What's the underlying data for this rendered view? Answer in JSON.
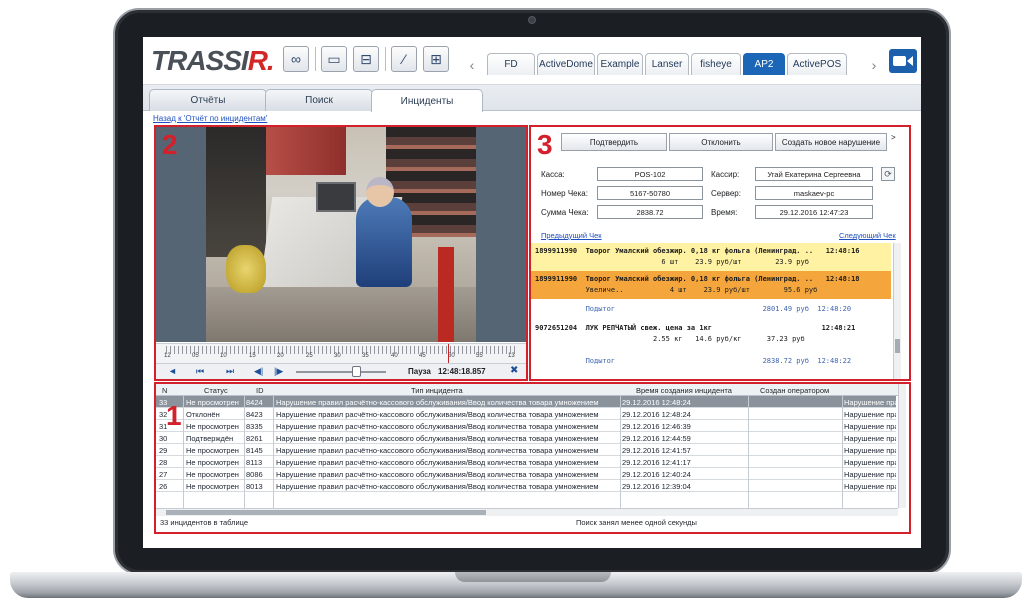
{
  "logo": {
    "text_main": "TRASSI",
    "text_accent": "R",
    "trail": "."
  },
  "toolbar": {
    "icons": [
      "pair-view-icon",
      "monitor-icon",
      "tree-icon",
      "magic-wand-icon",
      "layout-edit-icon"
    ]
  },
  "camera_tabs": {
    "prev": "‹",
    "next": "›",
    "items": [
      {
        "label": "FD"
      },
      {
        "label": "ActiveDome"
      },
      {
        "label": "Example"
      },
      {
        "label": "Lanser"
      },
      {
        "label": "fisheye"
      },
      {
        "label": "AP2",
        "active": true
      },
      {
        "label": "ActivePOS"
      }
    ]
  },
  "main_tabs": [
    {
      "label": "Отчёты"
    },
    {
      "label": "Поиск"
    },
    {
      "label": "Инциденты",
      "active": true
    }
  ],
  "back_link": "Назад к 'Отчёт по инцидентам'",
  "panel_labels": {
    "video": "2",
    "receipt": "3",
    "table": "1"
  },
  "video": {
    "tick_labels": [
      "12",
      "05",
      "10",
      "15",
      "20",
      "25",
      "30",
      "35",
      "40",
      "45",
      "50",
      "55",
      "13"
    ],
    "controls": {
      "prev_frame": "◄",
      "skip_back": "⏮",
      "skip_fwd": "⏭",
      "step_back": "◀|",
      "step_fwd": "|▶"
    },
    "state_label": "Пауза",
    "time": "12:48:18.857",
    "close": "✖"
  },
  "receipt_panel": {
    "buttons": {
      "confirm": "Подтвердить",
      "reject": "Отклонить",
      "new_violation": "Создать новое нарушение",
      "more": ">"
    },
    "fields": {
      "kassa_label": "Касса:",
      "kassa_value": "POS-102",
      "cashier_label": "Кассир:",
      "cashier_value": "Угай Екатерина Сергеевна",
      "check_num_label": "Номер Чека:",
      "check_num_value": "5167-50780",
      "server_label": "Сервер:",
      "server_value": "maskaev-pc",
      "sum_label": "Сумма Чека:",
      "sum_value": "2838.72",
      "time_label": "Время:",
      "time_value": "29.12.2016 12:47:23"
    },
    "prev_check": "Предыдущий Чек",
    "next_check": "Следующий Чек",
    "lines": [
      {
        "l1": "1899911990  Творог Умалский обезжир. 0,18 кг фольга (Ленинград. ..   12:48:16",
        "l2": "                              6 шт    23.9 руб/шт        23.9 руб",
        "style": "yellow"
      },
      {
        "l1": "1899911990  Творог Умалский обезжир. 0,18 кг фольга (Ленинград. ..   12:48:18",
        "l2": "            Увеличе..           4 шт    23.9 руб/шт        95.6 руб",
        "style": "orange"
      },
      {
        "l1": "            Подытог                                   2801.49 руб  12:48:20",
        "l2": "",
        "style": "sub"
      },
      {
        "l1": "9072651204  ЛУК РЕПЧАТЫЙ свеж. цена за 1кг                          12:48:21",
        "l2": "                            2.55 кг   14.6 руб/кг      37.23 руб",
        "style": "plain"
      },
      {
        "l1": "            Подытог                                   2838.72 руб  12:48:22",
        "l2": "",
        "style": "sub"
      }
    ]
  },
  "table": {
    "headers": [
      "N",
      "Статус",
      "ID",
      "Тип инцидента",
      "Время создания инцидента",
      "Создан оператором",
      ""
    ],
    "rows": [
      {
        "n": "33",
        "status": "Не просмотрен",
        "id": "8424",
        "type": "Нарушение правил расчётно-кассового обслуживания/Ввод количества товара умножением",
        "time": "29.12.2016 12:48:24",
        "op": "",
        "extra": "Нарушение пра"
      },
      {
        "n": "32",
        "status": "Отклонён",
        "id": "8423",
        "type": "Нарушение правил расчётно-кассового обслуживания/Ввод количества товара умножением",
        "time": "29.12.2016 12:48:24",
        "op": "",
        "extra": "Нарушение пра"
      },
      {
        "n": "31",
        "status": "Не просмотрен",
        "id": "8335",
        "type": "Нарушение правил расчётно-кассового обслуживания/Ввод количества товара умножением",
        "time": "29.12.2016 12:46:39",
        "op": "",
        "extra": "Нарушение пра"
      },
      {
        "n": "30",
        "status": "Подтверждён",
        "id": "8261",
        "type": "Нарушение правил расчётно-кассового обслуживания/Ввод количества товара умножением",
        "time": "29.12.2016 12:44:59",
        "op": "",
        "extra": "Нарушение пра"
      },
      {
        "n": "29",
        "status": "Не просмотрен",
        "id": "8145",
        "type": "Нарушение правил расчётно-кассового обслуживания/Ввод количества товара умножением",
        "time": "29.12.2016 12:41:57",
        "op": "",
        "extra": "Нарушение пра"
      },
      {
        "n": "28",
        "status": "Не просмотрен",
        "id": "8113",
        "type": "Нарушение правил расчётно-кассового обслуживания/Ввод количества товара умножением",
        "time": "29.12.2016 12:41:17",
        "op": "",
        "extra": "Нарушение пра"
      },
      {
        "n": "27",
        "status": "Не просмотрен",
        "id": "8086",
        "type": "Нарушение правил расчётно-кассового обслуживания/Ввод количества товара умножением",
        "time": "29.12.2016 12:40:24",
        "op": "",
        "extra": "Нарушение пра"
      },
      {
        "n": "26",
        "status": "Не просмотрен",
        "id": "8013",
        "type": "Нарушение правил расчётно-кассового обслуживания/Ввод количества товара умножением",
        "time": "29.12.2016 12:39:04",
        "op": "",
        "extra": "Нарушение пра"
      }
    ],
    "footer_count": "33 инцидентов в таблице",
    "footer_search": "Поиск занял менее одной секунды"
  },
  "colors": {
    "accent_red": "#d4202a",
    "brand_blue": "#1c66b8",
    "highlight_yellow": "#fff3a3",
    "highlight_orange": "#f4a63d"
  }
}
